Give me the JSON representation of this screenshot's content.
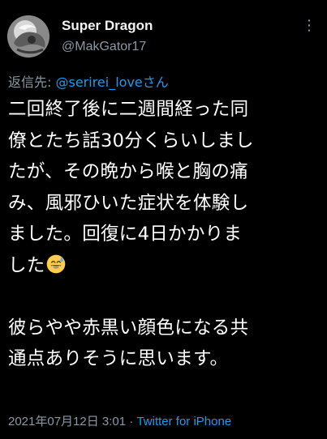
{
  "tweet": {
    "display_name": "Super Dragon",
    "handle": "@MakGator17",
    "more_icon": "more-vertical-icon",
    "reply_prefix": "返信先: ",
    "reply_to": "@serirei_loveさん",
    "lines": [
      "二回終了後に二週間経った同",
      "僚とたち話30分くらいしまし",
      "たが、その晩から喉と胸の痛",
      "み、風邪ひいた症状を体験し",
      "ました。回復に4日かかりま",
      "した"
    ],
    "emoji": "sweat-smile-emoji",
    "lines2": [
      "彼らやや赤黒い顔色になる共",
      "通点ありそうに思います。"
    ],
    "date": "2021年07月12日 3:01",
    "separator": " · ",
    "source": "Twitter for iPhone"
  },
  "colors": {
    "background": "#000000",
    "text": "#ffffff",
    "muted": "#8b98a5",
    "link": "#1d9bf0"
  }
}
